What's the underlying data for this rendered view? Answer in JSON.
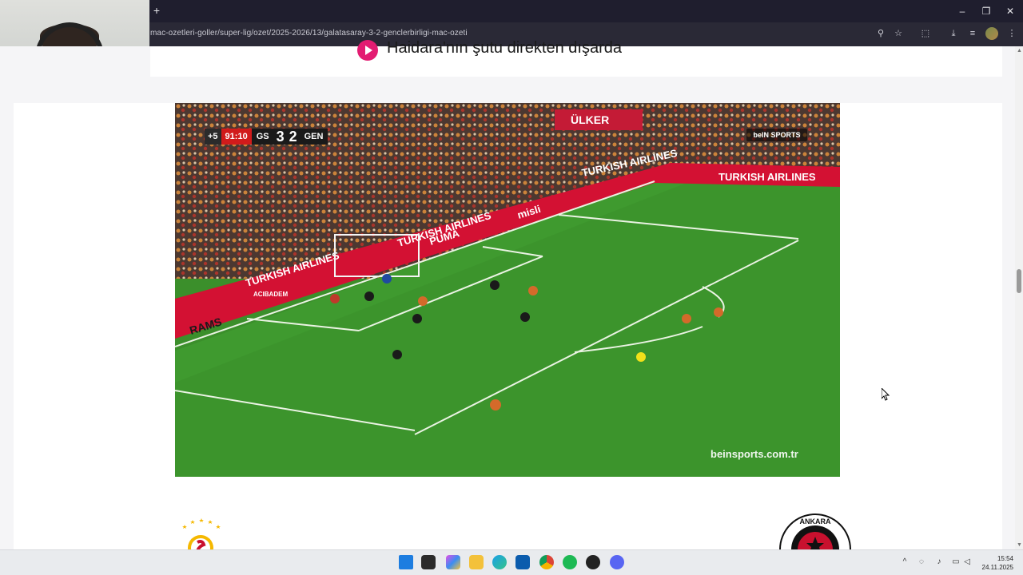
{
  "browser": {
    "url": "mac-ozetleri-goller/super-lig/ozet/2025-2026/13/galatasaray-3-2-genclerbirligi-mac-ozeti",
    "new_tab_label": "+",
    "window_controls": [
      "–",
      "❐",
      "✕"
    ]
  },
  "page": {
    "event_title": "Haidara'nın şutu direkten dışarda"
  },
  "video": {
    "scorebug": {
      "added_time": "+5",
      "clock": "91:10",
      "home_team": "GS",
      "home_score": "3",
      "away_score": "2",
      "away_team": "GEN"
    },
    "broadcaster_logo": "beIN SPORTS",
    "watermark": "beinsports.com.tr",
    "boards": [
      "TURKISH AIRLINES",
      "TURKISH AIRLINES",
      "TURKISH AIRLINES",
      "TURKISH AIRLINES",
      "misli",
      "PUMA",
      "RAMS",
      "ACIBADEM",
      "ÜLKER"
    ]
  },
  "match": {
    "home_crest": "galatasaray-crest",
    "away_crest": "genclerbirligi-crest",
    "away_crest_text": "ANKARA"
  },
  "taskbar": {
    "time": "15:54",
    "date": "24.11.2025"
  },
  "colors": {
    "accent": "#e31c72",
    "chrome_dark": "#1f1e2e",
    "pitch": "#3b8f2b"
  }
}
